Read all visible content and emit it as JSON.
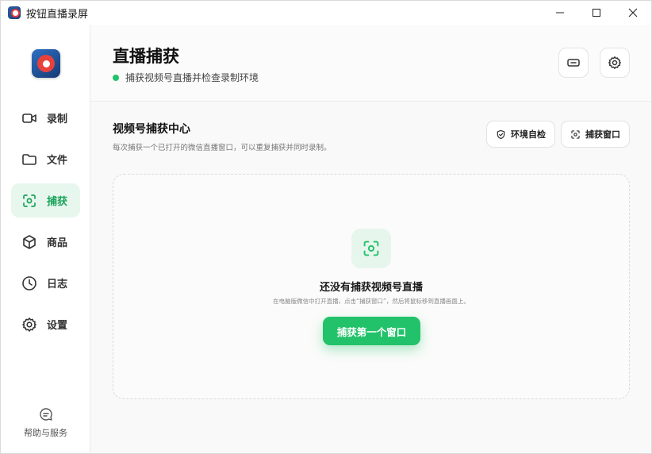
{
  "window": {
    "title": "按钮直播录屏"
  },
  "sidebar": {
    "items": [
      {
        "label": "录制",
        "icon": "video-camera-icon"
      },
      {
        "label": "文件",
        "icon": "folder-icon"
      },
      {
        "label": "捕获",
        "icon": "capture-icon",
        "active": true
      },
      {
        "label": "商品",
        "icon": "box-icon"
      },
      {
        "label": "日志",
        "icon": "clock-icon"
      },
      {
        "label": "设置",
        "icon": "gear-icon"
      }
    ],
    "help_label": "帮助与服务"
  },
  "header": {
    "title": "直播捕获",
    "status": "捕获视频号直播并检查录制环境"
  },
  "section": {
    "title": "视频号捕获中心",
    "subtitle": "每次捕获一个已打开的微信直播窗口，可以重复捕获并同时录制。",
    "env_check_label": "环境自检",
    "capture_window_label": "捕获窗口"
  },
  "empty_state": {
    "title": "还没有捕获视频号直播",
    "hint": "在电脑版微信中打开直播，点击“捕获窗口”，然后将鼠标移到直播画面上。",
    "cta_label": "捕获第一个窗口"
  },
  "colors": {
    "accent": "#22c26a",
    "active_bg": "#e8f7ee"
  }
}
